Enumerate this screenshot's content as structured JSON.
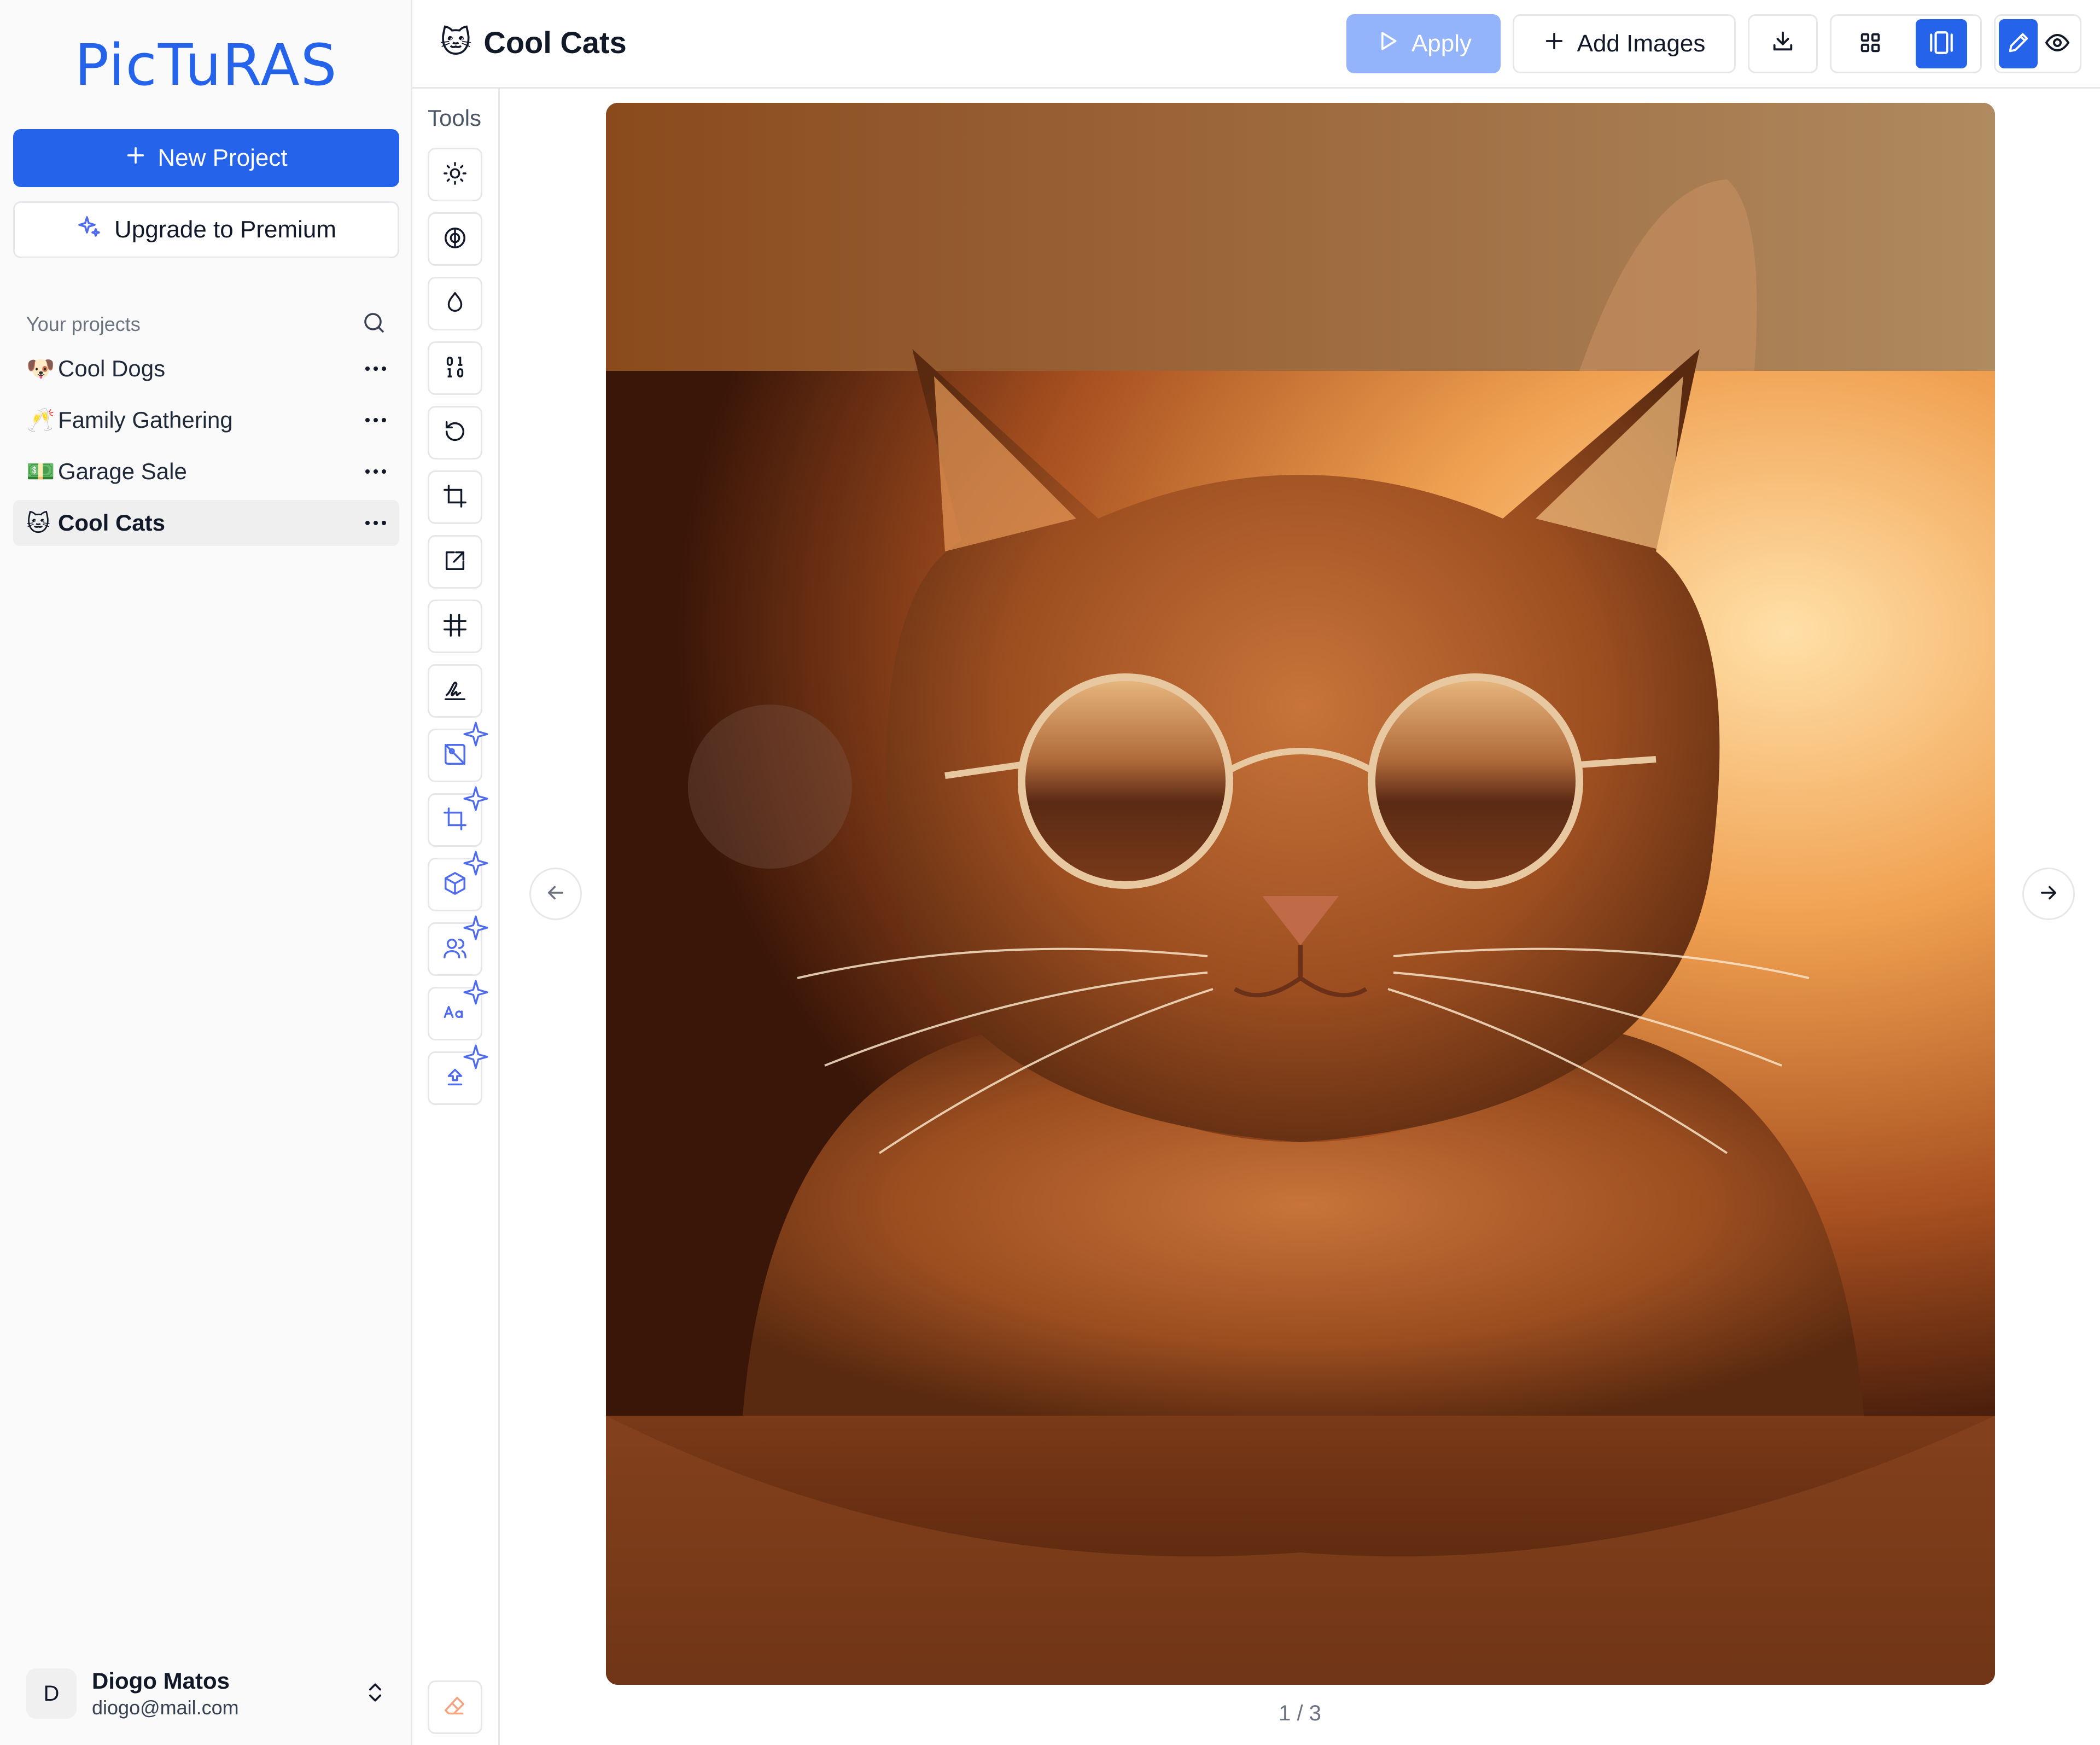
{
  "app": {
    "logo": "PicTuRAS"
  },
  "sidebar": {
    "new_project_label": "New Project",
    "upgrade_label": "Upgrade to Premium",
    "projects_heading": "Your projects",
    "projects": [
      {
        "emoji": "🐶",
        "name": "Cool Dogs",
        "active": false
      },
      {
        "emoji": "🥂",
        "name": "Family Gathering",
        "active": false
      },
      {
        "emoji": "💵",
        "name": "Garage Sale",
        "active": false
      },
      {
        "emoji": "🐱",
        "name": "Cool Cats",
        "active": true
      }
    ],
    "user": {
      "initial": "D",
      "name": "Diogo Matos",
      "email": "diogo@mail.com"
    }
  },
  "header": {
    "title_emoji": "🐱",
    "title": "Cool Cats",
    "apply_label": "Apply",
    "add_images_label": "Add Images"
  },
  "tools": {
    "label": "Tools",
    "items": [
      {
        "icon": "sun-icon",
        "premium": false
      },
      {
        "icon": "contrast-icon",
        "premium": false
      },
      {
        "icon": "droplet-icon",
        "premium": false
      },
      {
        "icon": "binary-icon",
        "premium": false
      },
      {
        "icon": "rotate-icon",
        "premium": false
      },
      {
        "icon": "crop-icon",
        "premium": false
      },
      {
        "icon": "resize-icon",
        "premium": false
      },
      {
        "icon": "frame-icon",
        "premium": false
      },
      {
        "icon": "signature-icon",
        "premium": false
      },
      {
        "icon": "remove-background-icon",
        "premium": true
      },
      {
        "icon": "smart-crop-icon",
        "premium": true
      },
      {
        "icon": "object-detect-icon",
        "premium": true
      },
      {
        "icon": "people-count-icon",
        "premium": true
      },
      {
        "icon": "text-extract-icon",
        "premium": true
      },
      {
        "icon": "upscale-icon",
        "premium": true
      }
    ]
  },
  "viewer": {
    "pager": "1 / 3"
  },
  "colors": {
    "accent": "#2563eb",
    "accent_disabled": "#93b4fb",
    "premium_spark": "#4f6bed"
  }
}
